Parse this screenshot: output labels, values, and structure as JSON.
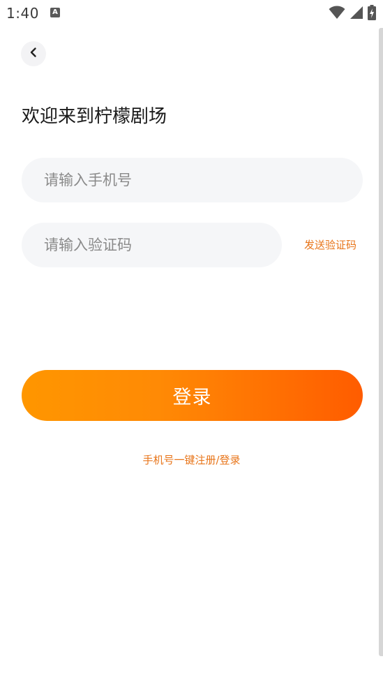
{
  "status_bar": {
    "time": "1:40",
    "notification_icon": "a-icon",
    "right_icons": [
      "wifi-icon",
      "signal-icon",
      "battery-charging-icon"
    ]
  },
  "header": {
    "back_icon": "chevron-left-icon",
    "title": "欢迎来到柠檬剧场"
  },
  "form": {
    "phone_placeholder": "请输入手机号",
    "phone_value": "",
    "code_placeholder": "请输入验证码",
    "code_value": "",
    "send_code_label": "发送验证码"
  },
  "actions": {
    "login_label": "登录",
    "oneclick_label": "手机号一键注册/登录"
  },
  "colors": {
    "accent": "#e8751a",
    "button_gradient_start": "#ff9600",
    "button_gradient_end": "#ff5c00",
    "field_background": "#f5f6f8"
  }
}
